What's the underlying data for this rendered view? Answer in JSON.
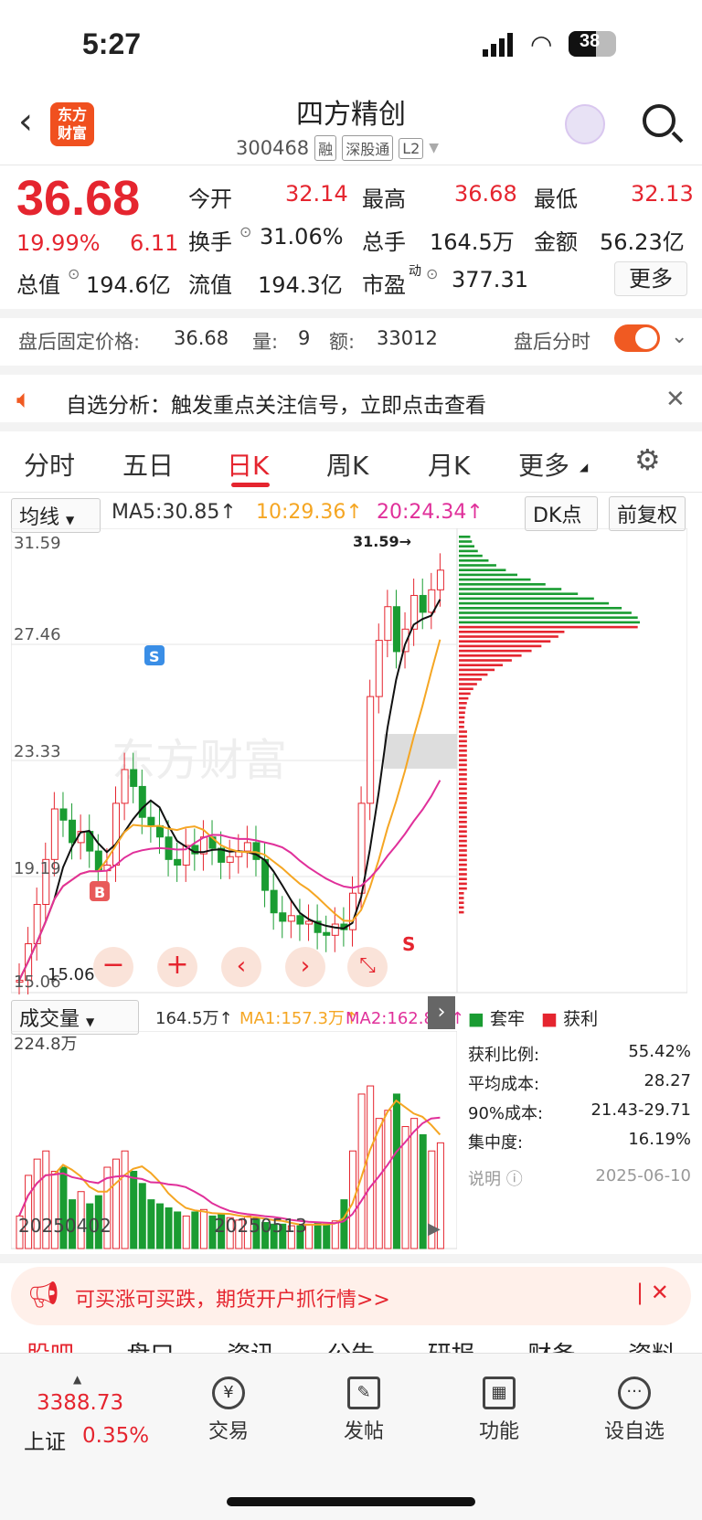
{
  "status": {
    "time": "5:27",
    "battery": "38"
  },
  "header": {
    "logo_line1": "东方",
    "logo_line2": "财富",
    "title": "四方精创",
    "code": "300468",
    "tags": [
      "融",
      "深股通",
      "L2"
    ]
  },
  "quote": {
    "price": "36.68",
    "change_pct": "19.99%",
    "change": "6.11",
    "open_label": "今开",
    "open": "32.14",
    "high_label": "最高",
    "high": "36.68",
    "low_label": "最低",
    "low": "32.13",
    "turnover_label": "换手",
    "turnover": "31.06%",
    "volume_label": "总手",
    "volume": "164.5万",
    "amount_label": "金额",
    "amount": "56.23亿",
    "mktcap_label": "总值",
    "mktcap": "194.6亿",
    "float_label": "流值",
    "float": "194.3亿",
    "pe_label": "市盈",
    "pe_sup": "动",
    "pe": "377.31",
    "more": "更多"
  },
  "after_hours": {
    "label": "盘后固定价格:",
    "price": "36.68",
    "vol_label": "量:",
    "vol": "9",
    "amt_label": "额:",
    "amt": "33012",
    "toggle_label": "盘后分时"
  },
  "analysis": {
    "text": "自选分析：触发重点关注信号，立即点击查看"
  },
  "tabs": [
    "分时",
    "五日",
    "日K",
    "周K",
    "月K",
    "更多"
  ],
  "active_tab": "日K",
  "kline": {
    "indicator": "均线",
    "ma5": "MA5:30.85↑",
    "ma10": "10:29.36↑",
    "ma20": "20:24.34↑",
    "dk_btn": "DK点",
    "fq_btn": "前复权",
    "axis_top": "31.59",
    "axis_2": "27.46",
    "axis_3": "23.33",
    "axis_4": "19.19",
    "axis_bottom": "15.06",
    "high_note": "31.59→",
    "low_note": "15.06",
    "watermark": "东方财富",
    "markers": {
      "S": "S",
      "B": "B",
      "S2": "S"
    },
    "colors": {
      "up": "#e5252f",
      "down": "#1a9c32",
      "ma5": "#111111",
      "ma10": "#f5a623",
      "ma20": "#e0309a"
    }
  },
  "volume": {
    "indicator": "成交量",
    "vol": "164.5万↑",
    "ma1": "MA1:157.3万↑",
    "ma2": "MA2:162.8万↑",
    "axis_top": "224.8万",
    "date_left": "20250402",
    "date_mid": "20250513"
  },
  "chip": {
    "legend_trap": "套牢",
    "legend_profit": "获利",
    "rows": [
      {
        "label": "获利比例:",
        "value": "55.42%"
      },
      {
        "label": "平均成本:",
        "value": "28.27"
      },
      {
        "label": "90%成本:",
        "value": "21.43-29.71"
      },
      {
        "label": "集中度:",
        "value": "16.19%"
      }
    ],
    "note": "说明",
    "date": "2025-06-10"
  },
  "banner": {
    "text": "可买涨可买跌，期货开户抓行情>>"
  },
  "subtabs": [
    "股吧",
    "盘口",
    "资讯",
    "公告",
    "研报",
    "财务",
    "资料"
  ],
  "bottom": {
    "index_value": "3388.73",
    "index_name": "上证",
    "index_pct": "0.35%",
    "nav": [
      "交易",
      "发帖",
      "功能",
      "设自选"
    ]
  }
}
